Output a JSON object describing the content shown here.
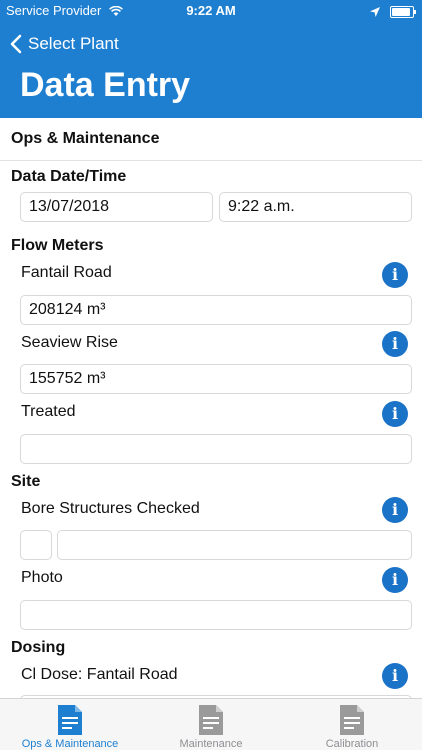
{
  "status_bar": {
    "carrier": "Service Provider",
    "time": "9:22 AM"
  },
  "nav": {
    "back_label": "Select Plant",
    "title": "Data Entry"
  },
  "sections": {
    "ops": "Ops & Maintenance",
    "datetime": {
      "heading": "Data Date/Time",
      "date": "13/07/2018",
      "time": "9:22 a.m."
    },
    "flow_meters": {
      "heading": "Flow Meters",
      "items": [
        {
          "label": "Fantail Road",
          "value": "208124 m³"
        },
        {
          "label": "Seaview Rise",
          "value": "155752 m³"
        },
        {
          "label": "Treated",
          "value": ""
        }
      ]
    },
    "site": {
      "heading": "Site",
      "bore_label": "Bore Structures Checked",
      "photo_label": "Photo"
    },
    "dosing": {
      "heading": "Dosing",
      "cl_label": "Cl Dose: Fantail Road"
    }
  },
  "info_glyph": "i",
  "tabs": [
    {
      "label": "Ops & Maintenance",
      "icon": "document-icon",
      "active": true
    },
    {
      "label": "Maintenance",
      "icon": "document-icon",
      "active": false
    },
    {
      "label": "Calibration",
      "icon": "document-icon",
      "active": false
    }
  ],
  "colors": {
    "accent": "#1e7fd0",
    "info": "#1a73c6",
    "inactive_tab": "#8e8e93"
  }
}
